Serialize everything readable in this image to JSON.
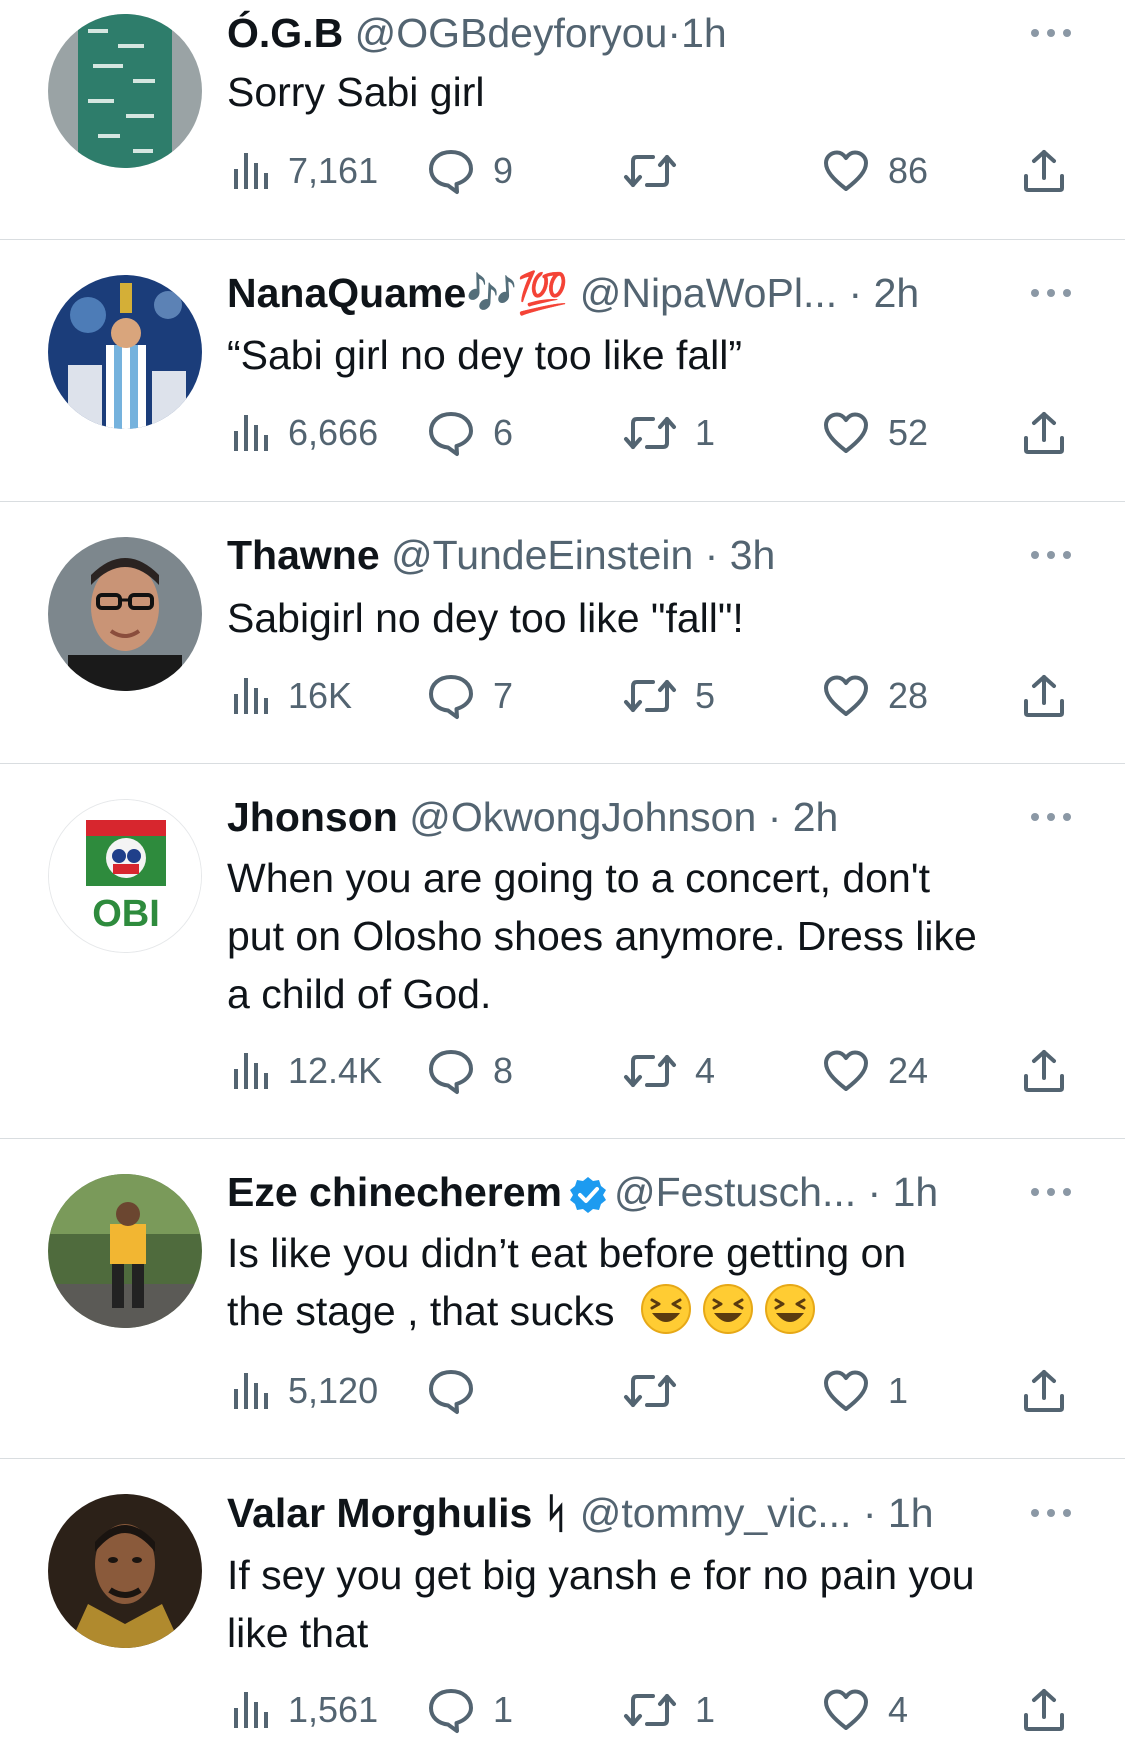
{
  "tweets": [
    {
      "name": "Ó.G.B",
      "handle": "@OGBdeyforyou",
      "time": "1h",
      "text": [
        "Sorry Sabi girl"
      ],
      "views": "7,161",
      "replies": "9",
      "retweets": "",
      "likes": "86",
      "avatar": "avatar-printed-outfit"
    },
    {
      "name": "NanaQuame",
      "name_emoji": "🎶💯",
      "handle": "@NipaWoPl...",
      "time": "2h",
      "text": [
        "“Sabi girl no dey too like fall”"
      ],
      "views": "6,666",
      "replies": "6",
      "retweets": "1",
      "likes": "52",
      "avatar": "avatar-trophy-celebration"
    },
    {
      "name": "Thawne",
      "handle": "@TundeEinstein",
      "time": "3h",
      "text": [
        "Sabigirl no dey too like \"fall\"!"
      ],
      "views": "16K",
      "replies": "7",
      "retweets": "5",
      "likes": "28",
      "avatar": "avatar-man-glasses"
    },
    {
      "name": "Jhonson",
      "handle": "@OkwongJohnson",
      "time": "2h",
      "text": [
        "When you are going to a concert, don't",
        "put on Olosho shoes anymore. Dress like",
        "a child of God."
      ],
      "views": "12.4K",
      "replies": "8",
      "retweets": "4",
      "likes": "24",
      "avatar": "avatar-obi-logo",
      "avatar_text": "OBI"
    },
    {
      "name": "Eze chinecherem",
      "verified": true,
      "handle": "@Festusch...",
      "time": "1h",
      "text": [
        "Is like you didn’t eat before getting on",
        "the stage , that sucks"
      ],
      "emoji": [
        "laughing-emoji",
        "laughing-emoji",
        "laughing-emoji"
      ],
      "views": "5,120",
      "replies": "",
      "retweets": "",
      "likes": "1",
      "avatar": "avatar-man-lakers-jersey"
    },
    {
      "name": "Valar Morghulis",
      "name_suffix": "ᛋ",
      "handle": "@tommy_vic...",
      "time": "1h",
      "text": [
        "If sey you get big yansh e for no pain you",
        "like that"
      ],
      "views": "1,561",
      "replies": "1",
      "retweets": "1",
      "likes": "4",
      "avatar": "avatar-man-costume"
    }
  ],
  "separator": "·",
  "icons": {
    "views": "views-chart-icon",
    "reply": "reply-bubble-icon",
    "retweet": "retweet-icon",
    "like": "heart-icon",
    "share": "share-icon",
    "more": "more-dots-icon",
    "verified": "verified-badge-icon"
  },
  "colors": {
    "text": "#0f1419",
    "secondary": "#536471",
    "verified": "#1d9bf0",
    "divider": "#d9dde0"
  }
}
